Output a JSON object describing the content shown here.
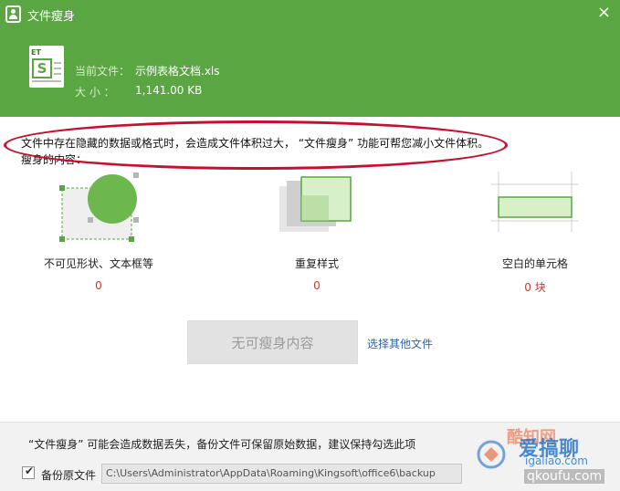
{
  "window": {
    "title": "文件瘦身",
    "close_glyph": "×"
  },
  "file": {
    "current_label": "当前文件：",
    "current_value": "示例表格文档.xls",
    "size_label": "大 小 ：",
    "size_value": "1,141.00 KB",
    "icon_badge": "ET",
    "icon_letter": "S"
  },
  "description": {
    "text": "文件中存在隐藏的数据或格式时，会造成文件体积过大， “文件瘦身” 功能可帮您减小文件体积。",
    "section_title": "瘦身的内容："
  },
  "items": [
    {
      "label": "不可见形状、文本框等",
      "count": "0"
    },
    {
      "label": "重复样式",
      "count": "0"
    },
    {
      "label": "空白的单元格",
      "count": "0 块"
    }
  ],
  "actions": {
    "shrink_button": "无可瘦身内容",
    "other_file_link": "选择其他文件"
  },
  "footer": {
    "warning": "“文件瘦身” 可能会造成数据丢失，备份文件可保留原始数据，建议保持勾选此项",
    "backup_label": "备份原文件",
    "backup_checked": true,
    "backup_path": "C:\\Users\\Administrator\\AppData\\Roaming\\Kingsoft\\office6\\backup"
  },
  "watermark": {
    "line1": "酷知网",
    "line2": "爱搞聊",
    "line3": "igaliao.com",
    "line4": "qkoufu.com"
  },
  "colors": {
    "header_green": "#5aa642",
    "count_red": "#c0392b",
    "link_blue": "#2a63b4",
    "highlight_red": "#c8102e"
  }
}
